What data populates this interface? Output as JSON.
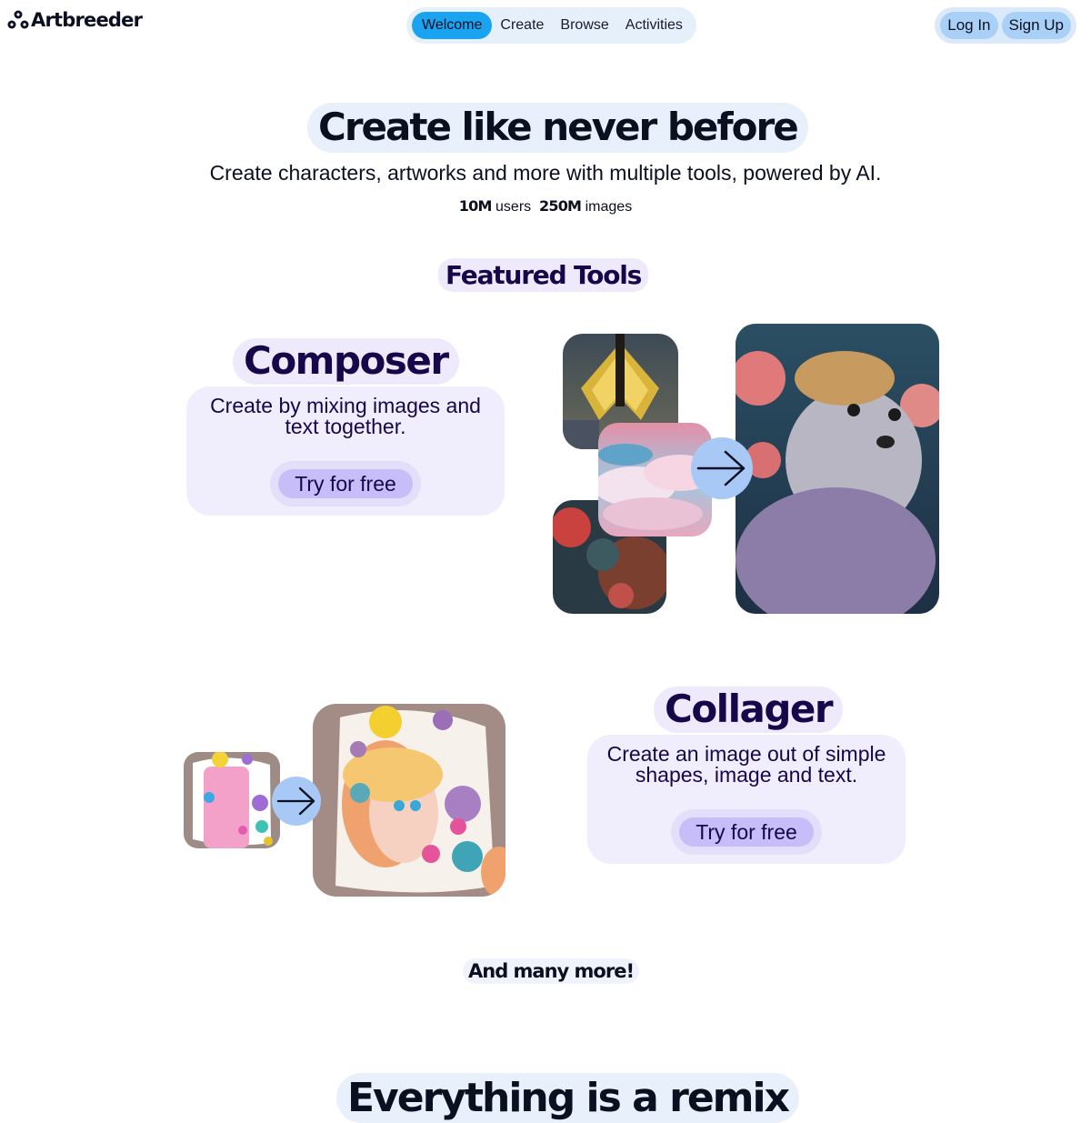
{
  "header": {
    "logo_text": "Artbreeder",
    "logo_icon": "artbreeder-logo-icon",
    "nav": [
      {
        "label": "Welcome",
        "active": true
      },
      {
        "label": "Create",
        "active": false
      },
      {
        "label": "Browse",
        "active": false
      },
      {
        "label": "Activities",
        "active": false
      }
    ],
    "login_label": "Log In",
    "signup_label": "Sign Up"
  },
  "hero": {
    "title": "Create like never before",
    "subtitle": "Create characters, artworks and more with multiple tools, powered by AI.",
    "stats": [
      {
        "value": "10M",
        "label": "users"
      },
      {
        "value": "250M",
        "label": "images"
      }
    ]
  },
  "featured": {
    "title": "Featured Tools",
    "tools": [
      {
        "name": "Composer",
        "description": "Create by mixing images and text together.",
        "cta": "Try for free"
      },
      {
        "name": "Collager",
        "description": "Create an image out of simple shapes, image and text.",
        "cta": "Try for free"
      }
    ]
  },
  "more_label": "And many more!",
  "remix_title": "Everything is a remix",
  "colors": {
    "accent": "#1aa3f0",
    "tool_bg": "#f0edfd",
    "tool_button": "#c7bdf8",
    "tool_text": "#16074a",
    "arrow_bg": "#a8c8f5"
  },
  "icons": [
    "artbreeder-logo-icon",
    "arrow-right-icon"
  ]
}
